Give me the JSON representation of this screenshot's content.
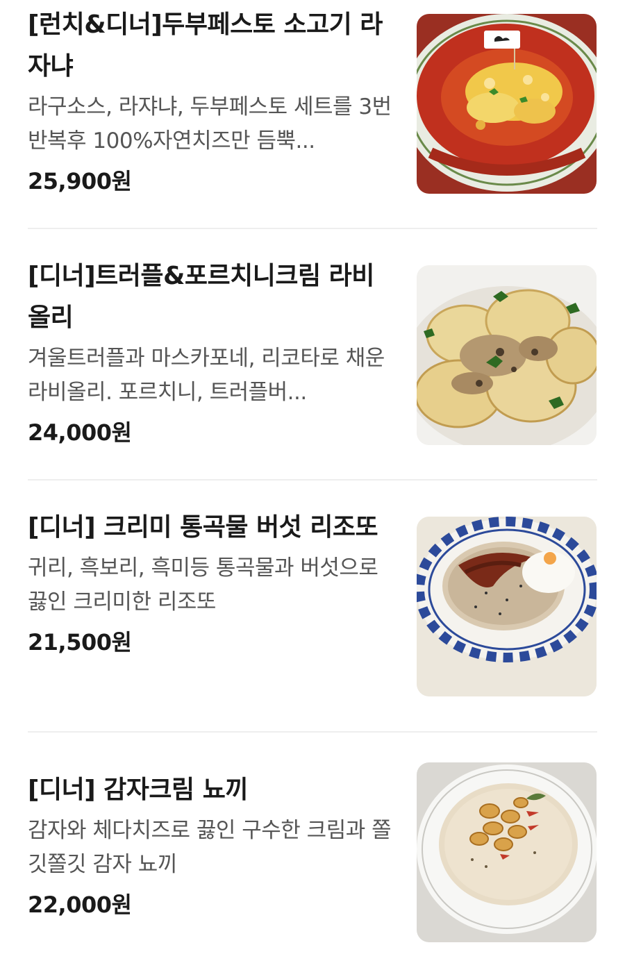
{
  "menu": {
    "items": [
      {
        "title": "[런치&디너]두부페스토 소고기 라자냐",
        "description": "라구소스, 라쟈냐, 두부페스토 세트를 3번 반복후 100%자연치즈만 듬뿍...",
        "price": "25,900원",
        "image_icon": "lasagna-photo"
      },
      {
        "title": "[디너]트러플&포르치니크림 라비올리",
        "description": "겨울트러플과 마스카포네, 리코타로 채운 라비올리. 포르치니, 트러플버...",
        "price": "24,000원",
        "image_icon": "ravioli-photo"
      },
      {
        "title": "[디너] 크리미 통곡물 버섯 리조또",
        "description": "귀리, 흑보리, 흑미등 통곡물과 버섯으로 끓인 크리미한 리조또",
        "price": "21,500원",
        "image_icon": "risotto-photo"
      },
      {
        "title": "[디너] 감자크림 뇨끼",
        "description": "감자와 체다치즈로 끓인 구수한 크림과 쫄깃쫄깃 감자 뇨끼",
        "price": "22,000원",
        "image_icon": "gnocchi-photo"
      }
    ]
  }
}
